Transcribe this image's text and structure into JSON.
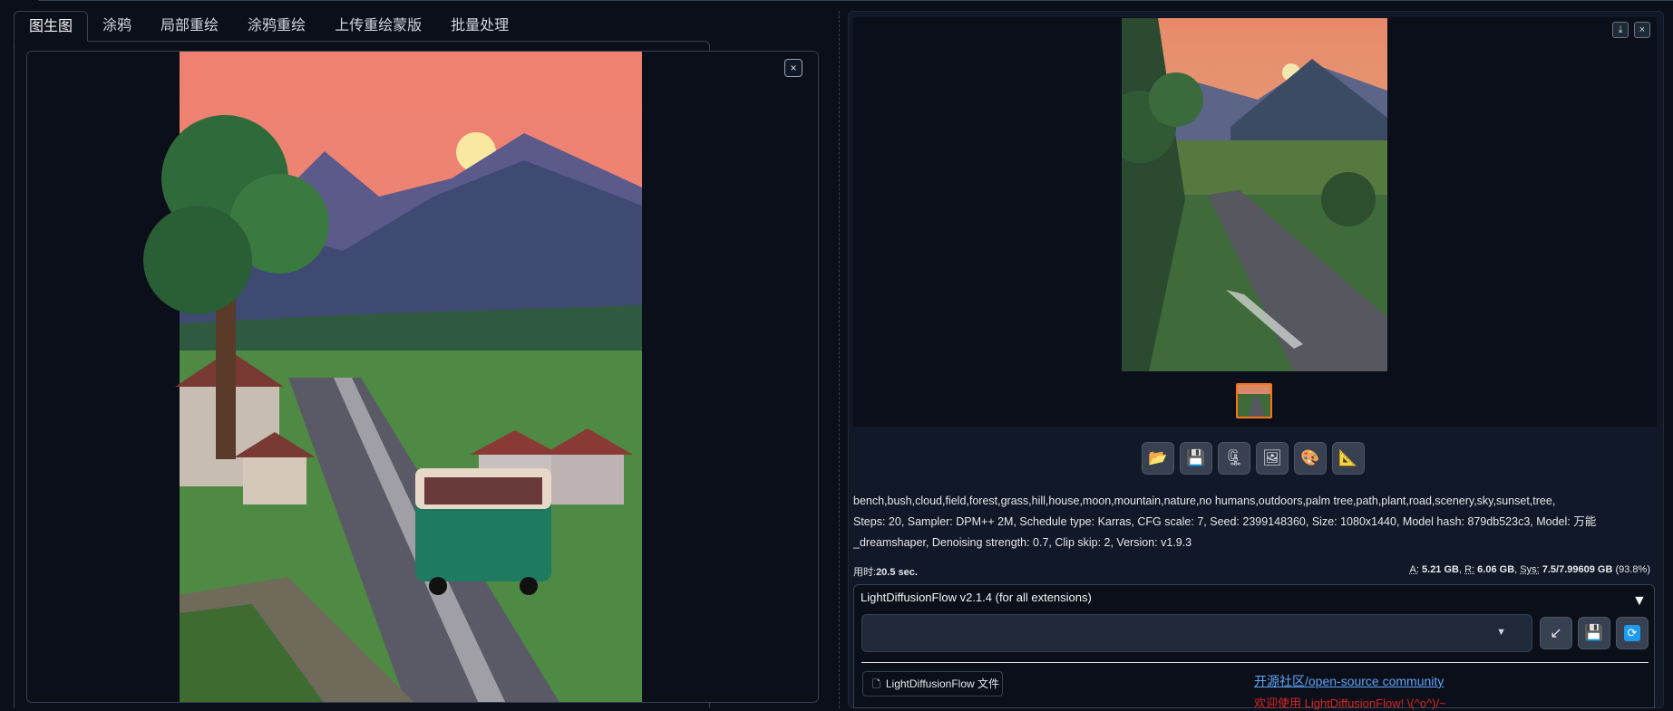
{
  "tabs": [
    "图生图",
    "涂鸦",
    "局部重绘",
    "涂鸦重绘",
    "上传重绘蒙版",
    "批量处理"
  ],
  "left_image": {
    "close_label": "×"
  },
  "gallery": {
    "close_label": "×",
    "download_label": "⤓"
  },
  "toolbar": [
    {
      "name": "open-folder-button",
      "icon": "📂"
    },
    {
      "name": "save-button",
      "icon": "💾"
    },
    {
      "name": "zip-button",
      "icon": "🗜"
    },
    {
      "name": "send-to-img2img-button",
      "icon": "🖼"
    },
    {
      "name": "send-to-inpaint-button",
      "icon": "🎨"
    },
    {
      "name": "send-to-extras-button",
      "icon": "📐"
    }
  ],
  "generation_info": {
    "line1": "bench,bush,cloud,field,forest,grass,hill,house,moon,mountain,nature,no humans,outdoors,palm tree,path,plant,road,scenery,sky,sunset,tree,",
    "line2": "Steps: 20, Sampler: DPM++ 2M, Schedule type: Karras, CFG scale: 7, Seed: 2399148360, Size: 1080x1440, Model hash: 879db523c3, Model: 万能",
    "line3": "_dreamshaper, Denoising strength: 0.7, Clip skip: 2, Version: v1.9.3"
  },
  "timing": {
    "label": "用时:",
    "value": "20.5 sec."
  },
  "memory": {
    "a_label": "A:",
    "a_value": "5.21 GB",
    "r_label": "R:",
    "r_value": "6.06 GB",
    "sys_label": "Sys:",
    "sys_value": "7.5/7.99609 GB",
    "sys_pct": "(93.8%)"
  },
  "ldf": {
    "title": "LightDiffusionFlow v2.1.4 (for all extensions)",
    "arrow": "▼",
    "dropdown_caret": "▼",
    "file_button": "LightDiffusionFlow 文件",
    "community_link": "开源社区/open-source community",
    "welcome": "欢迎使用 LightDiffusionFlow! \\(^o^)/~"
  },
  "colors": {
    "bg": "#0b0f19",
    "panel": "#111827",
    "accent": "#f97316",
    "link": "#60a5fa",
    "welcome": "#dc2626"
  }
}
